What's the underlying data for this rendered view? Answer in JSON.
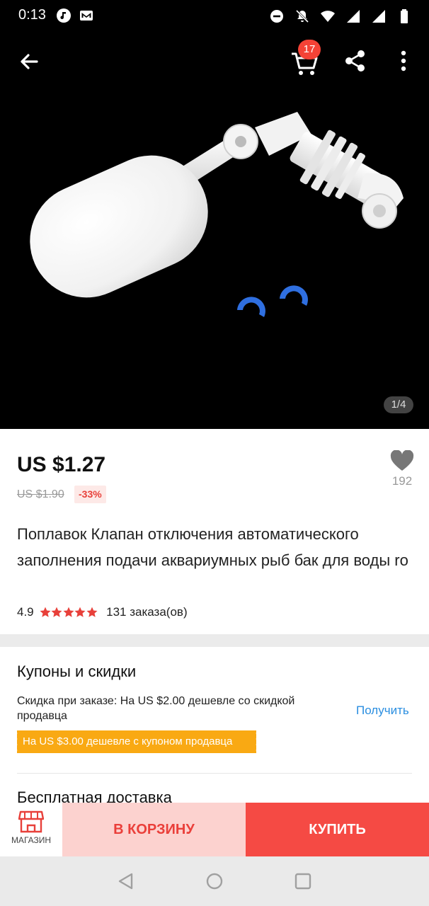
{
  "status_bar": {
    "time": "0:13",
    "icons": [
      "music-note-icon",
      "mail-icon",
      "do-not-disturb-icon",
      "notifications-off-icon",
      "wifi-icon",
      "signal-icon",
      "signal-icon",
      "battery-icon"
    ]
  },
  "topbar": {
    "cart_count": "17",
    "icons": [
      "back-arrow-icon",
      "cart-icon",
      "share-icon",
      "more-vert-icon"
    ]
  },
  "gallery": {
    "pager": "1/4"
  },
  "product": {
    "price": "US $1.27",
    "old_price": "US $1.90",
    "discount": "-33%",
    "wishlist_count": "192",
    "title": "Поплавок Клапан отключения автоматического заполнения подачи аквариумных рыб бак для воды ro",
    "rating": "4.9",
    "stars": 5,
    "orders": "131 заказа(ов)"
  },
  "coupons": {
    "title": "Купоны и скидки",
    "store_discount": "Скидка при заказе: На US $2.00 дешевле со скидкой продавца",
    "get_label": "Получить",
    "coupon_tag": "На US $3.00 дешевле с купоном продавца",
    "shipping_title": "Бесплатная доставка"
  },
  "actions": {
    "shop_label": "МАГАЗИН",
    "add_to_cart": "В КОРЗИНУ",
    "buy_now": "КУПИТЬ"
  },
  "colors": {
    "accent_red": "#f54a44",
    "cart_button_bg": "#fcd2cf",
    "coupon_orange": "#f9a913",
    "link_blue": "#2a8ee0",
    "star_red": "#e8403a"
  }
}
